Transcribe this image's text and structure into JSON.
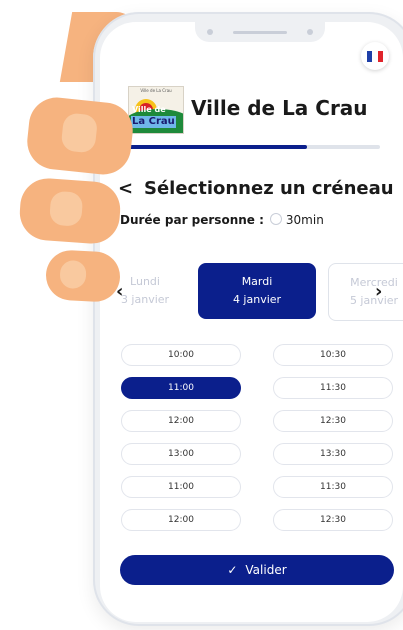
{
  "header": {
    "town_name": "Ville de La Crau",
    "logo": {
      "small_text": "Ville de La Crau",
      "ville": "Ville de",
      "lacrau": "La Crau"
    },
    "language_flag": "french-flag-icon",
    "progress_fraction": 0.72
  },
  "page": {
    "back_icon": "<",
    "title": "Sélectionnez un créneau",
    "duration_label": "Durée par personne :",
    "duration_value": "30min"
  },
  "days": {
    "prev": {
      "name": "Lundi",
      "date": "3 janvier"
    },
    "selected": {
      "name": "Mardi",
      "date": "4 janvier"
    },
    "next": {
      "name": "Mercredi",
      "date": "5 janvier"
    },
    "left_arrow": "‹",
    "right_arrow": "›"
  },
  "slots": {
    "left": [
      "10:00",
      "11:00",
      "12:00",
      "13:00",
      "11:00",
      "12:00"
    ],
    "right": [
      "10:30",
      "11:30",
      "12:30",
      "13:30",
      "11:30",
      "12:30"
    ],
    "selected": "11:00"
  },
  "footer": {
    "validate_label": "Valider",
    "check_icon": "✓"
  },
  "colors": {
    "accent": "#0b1f8c",
    "skin": "#f6b37f"
  }
}
